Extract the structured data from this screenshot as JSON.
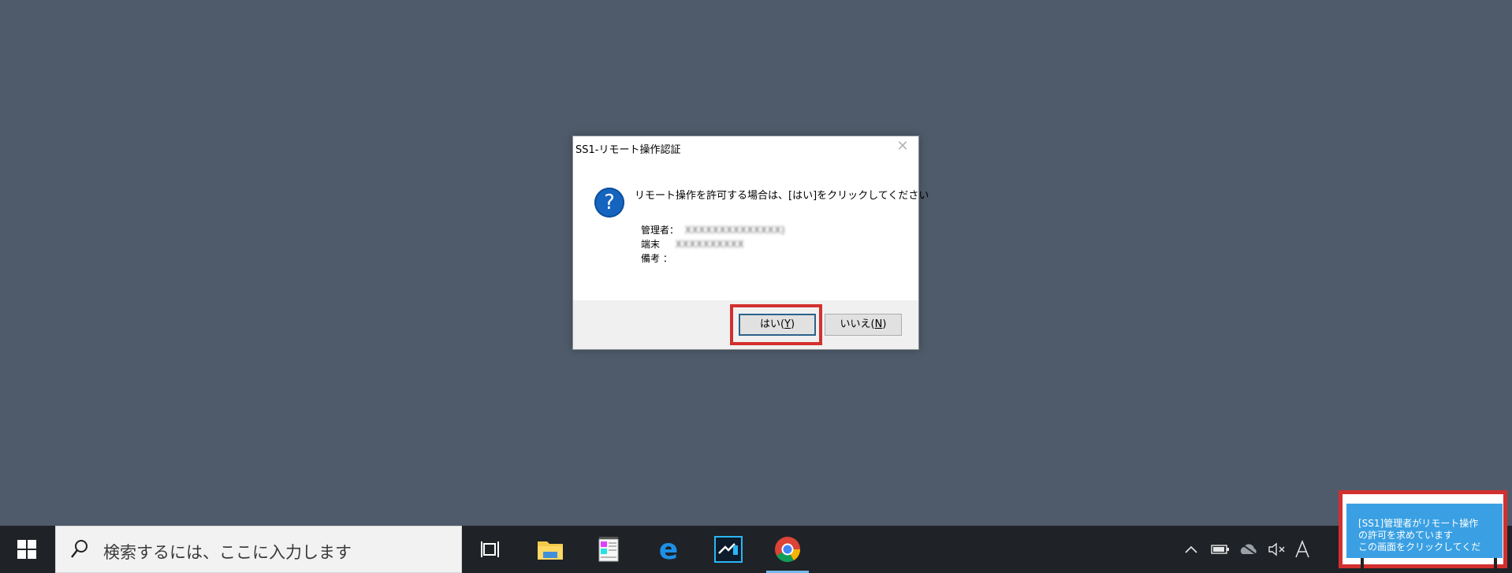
{
  "dialog": {
    "title": "SS1-リモート操作認証",
    "close_glyph": "✕",
    "icon_glyph": "?",
    "message": "リモート操作を許可する場合は、[はい]をクリックしてください",
    "details": {
      "admin_label": "管理者：",
      "admin_value": "XXXXXXXXXXXXXX)",
      "terminal_label": "端末",
      "terminal_value": "XXXXXXXXXX",
      "note_label": "備考 ：",
      "note_value": ""
    },
    "yes_button": {
      "text": "はい(",
      "key": "Y",
      "close": ")"
    },
    "no_button": {
      "text": "いいえ(",
      "key": "N",
      "close": ")"
    }
  },
  "taskbar": {
    "search_placeholder": "検索するには、ここに入力します",
    "apps": [
      "task-view",
      "file-explorer",
      "notepad",
      "edge",
      "remote-viewer",
      "chrome"
    ],
    "tray": [
      "chevron-up",
      "battery",
      "onedrive",
      "volume-muted",
      "ime-mode"
    ]
  },
  "notification": {
    "lines": [
      "[SS1]管理者がリモート操作",
      "の許可を求めています",
      "この画面をクリックしてくだ"
    ]
  },
  "colors": {
    "desktop": "#4f5b6a",
    "taskbar": "#1f2327",
    "highlight": "#d32f2f",
    "notification": "#3aa0e3",
    "question_icon": "#1565c0"
  }
}
